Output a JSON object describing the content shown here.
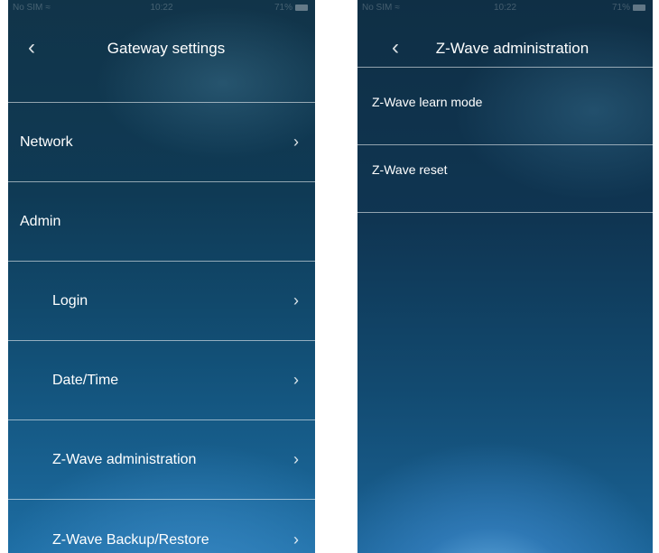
{
  "left": {
    "status": {
      "carrier": "No SIM",
      "time": "10:22",
      "battery": "71%"
    },
    "title": "Gateway settings",
    "back_icon": "chevron-left-icon",
    "items": [
      {
        "label": "Network",
        "has_chevron": true
      },
      {
        "label": "Admin",
        "has_chevron": false
      },
      {
        "label": "Login",
        "has_chevron": true
      },
      {
        "label": "Date/Time",
        "has_chevron": true
      },
      {
        "label": "Z-Wave administration",
        "has_chevron": true
      },
      {
        "label": "Z-Wave Backup/Restore",
        "has_chevron": true
      }
    ],
    "chevron": "›"
  },
  "right": {
    "status": {
      "carrier": "No SIM",
      "time": "10:22",
      "battery": "71%"
    },
    "title": "Z-Wave administration",
    "back_icon": "chevron-left-icon",
    "items": [
      {
        "label": "Z-Wave learn mode"
      },
      {
        "label": "Z-Wave reset"
      }
    ]
  },
  "colors": {
    "background_top": "#113449",
    "background_bottom": "#1d6da3",
    "divider": "#ffffff"
  }
}
